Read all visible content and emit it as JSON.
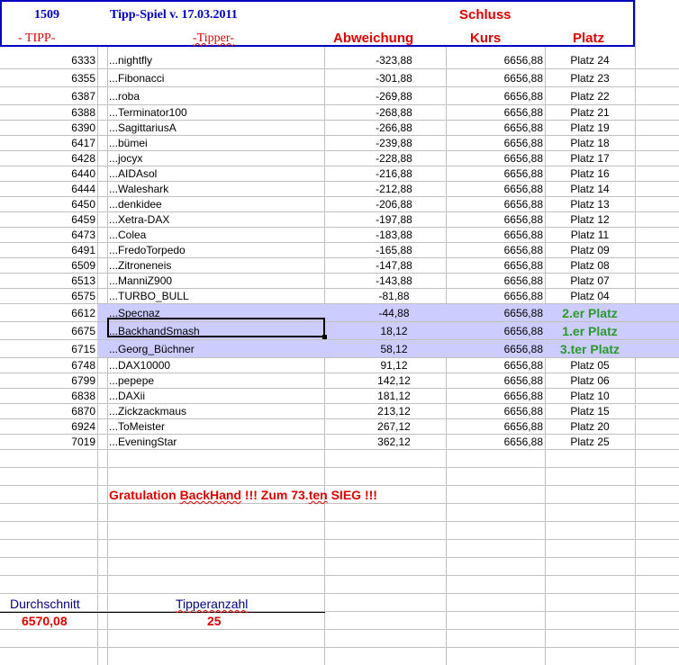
{
  "header": {
    "id": "1509",
    "title": "Tipp-Spiel v. 17.03.2011",
    "schluss": "Schluss",
    "tipp": "- TIPP-",
    "tipper": "-Tipper-",
    "abweichung": "Abweichung",
    "kurs": "Kurs",
    "platz": "Platz"
  },
  "rows": [
    {
      "tipp": "6333",
      "name": "...nightfly",
      "abw": "-323,88",
      "kurs": "6656,88",
      "platz": "Platz 24"
    },
    {
      "tipp": "6355",
      "name": "...Fibonacci",
      "abw": "-301,88",
      "kurs": "6656,88",
      "platz": "Platz 23"
    },
    {
      "tipp": "6387",
      "name": "...roba",
      "abw": "-269,88",
      "kurs": "6656,88",
      "platz": "Platz 22"
    },
    {
      "tipp": "6388",
      "name": "...Terminator100",
      "abw": "-268,88",
      "kurs": "6656,88",
      "platz": "Platz 21"
    },
    {
      "tipp": "6390",
      "name": "...SagittariusA",
      "abw": "-266,88",
      "kurs": "6656,88",
      "platz": "Platz 19"
    },
    {
      "tipp": "6417",
      "name": "...bümei",
      "abw": "-239,88",
      "kurs": "6656,88",
      "platz": "Platz 18"
    },
    {
      "tipp": "6428",
      "name": "...jocyx",
      "abw": "-228,88",
      "kurs": "6656,88",
      "platz": "Platz 17"
    },
    {
      "tipp": "6440",
      "name": "...AIDAsol",
      "abw": "-216,88",
      "kurs": "6656,88",
      "platz": "Platz 16"
    },
    {
      "tipp": "6444",
      "name": "...Waleshark",
      "abw": "-212,88",
      "kurs": "6656,88",
      "platz": "Platz 14"
    },
    {
      "tipp": "6450",
      "name": "...denkidee",
      "abw": "-206,88",
      "kurs": "6656,88",
      "platz": "Platz 13"
    },
    {
      "tipp": "6459",
      "name": "...Xetra-DAX",
      "abw": "-197,88",
      "kurs": "6656,88",
      "platz": "Platz 12"
    },
    {
      "tipp": "6473",
      "name": "...Colea",
      "abw": "-183,88",
      "kurs": "6656,88",
      "platz": "Platz 11"
    },
    {
      "tipp": "6491",
      "name": "...FredoTorpedo",
      "abw": "-165,88",
      "kurs": "6656,88",
      "platz": "Platz 09"
    },
    {
      "tipp": "6509",
      "name": "...Zitroneneis",
      "abw": "-147,88",
      "kurs": "6656,88",
      "platz": "Platz 08"
    },
    {
      "tipp": "6513",
      "name": "...ManniZ900",
      "abw": "-143,88",
      "kurs": "6656,88",
      "platz": "Platz 07"
    },
    {
      "tipp": "6575",
      "name": "...TURBO_BULL",
      "abw": "-81,88",
      "kurs": "6656,88",
      "platz": "Platz 04"
    },
    {
      "tipp": "6612",
      "name": "...Specnaz",
      "abw": "-44,88",
      "kurs": "6656,88",
      "platz": "2.er Platz",
      "winner": true
    },
    {
      "tipp": "6675",
      "name": "...BackhandSmash",
      "abw": "18,12",
      "kurs": "6656,88",
      "platz": "1.er Platz",
      "winner": true
    },
    {
      "tipp": "6715",
      "name": "...Georg_Büchner",
      "abw": "58,12",
      "kurs": "6656,88",
      "platz": "3.ter Platz",
      "winner": true
    },
    {
      "tipp": "6748",
      "name": "...DAX10000",
      "abw": "91,12",
      "kurs": "6656,88",
      "platz": "Platz 05"
    },
    {
      "tipp": "6799",
      "name": "...pepepe",
      "abw": "142,12",
      "kurs": "6656,88",
      "platz": "Platz 06"
    },
    {
      "tipp": "6838",
      "name": "...DAXii",
      "abw": "181,12",
      "kurs": "6656,88",
      "platz": "Platz 10"
    },
    {
      "tipp": "6870",
      "name": "...Zickzackmaus",
      "abw": "213,12",
      "kurs": "6656,88",
      "platz": "Platz 15"
    },
    {
      "tipp": "6924",
      "name": "...ToMeister",
      "abw": "267,12",
      "kurs": "6656,88",
      "platz": "Platz 20"
    },
    {
      "tipp": "7019",
      "name": "...EveningStar",
      "abw": "362,12",
      "kurs": "6656,88",
      "platz": "Platz 25"
    }
  ],
  "footer": {
    "gratulation_prefix": "Gratulation ",
    "gratulation_name": "BackHand",
    "gratulation_mid": " !!! Zum 73.",
    "gratulation_ten": "ten",
    "gratulation_suffix": " SIEG !!!",
    "durchschnitt_label": "Durchschnitt",
    "durchschnitt_value": "6570,08",
    "tipperanzahl_label": "Tipperanzahl",
    "tipperanzahl_value": "25"
  },
  "colors": {
    "header_blue": "#0000c0",
    "red": "#e00000",
    "highlight": "#ccccff",
    "winner_green": "#2a9a2a"
  }
}
